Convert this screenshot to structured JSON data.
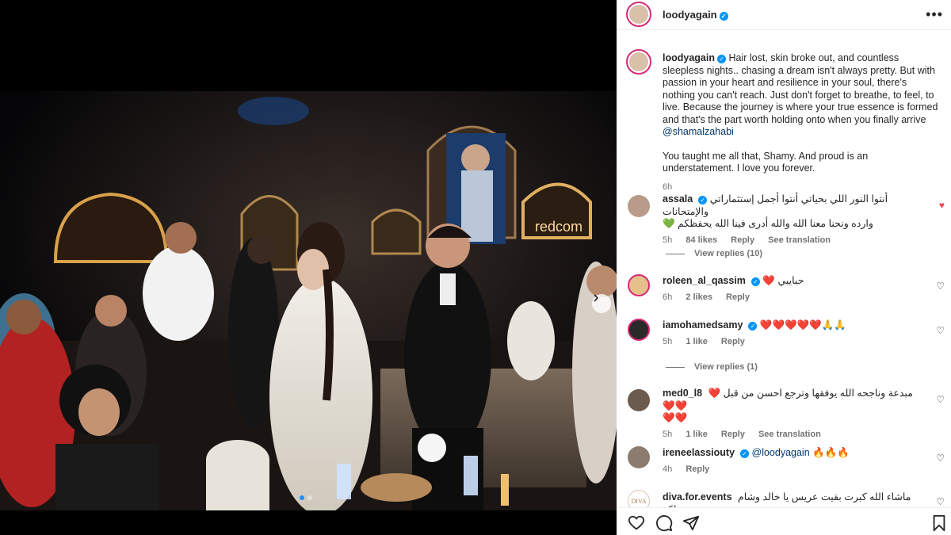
{
  "post": {
    "username": "loodyagain",
    "caption_p1": "Hair lost, skin broke out, and countless sleepless nights.. chasing a dream isn't always pretty. But with passion in your heart and resilience in your soul, there's nothing you can't reach. Just don't forget to breathe, to feel, to live. Because the journey is where your true essence is formed and that's the part worth holding onto when you finally arrive ",
    "caption_mention": "@shamalzahabi",
    "caption_p2": "You taught me all that, Shamy. And proud is an understatement. I love you forever.",
    "time": "6h"
  },
  "photo": {
    "screen_logo": "redcom"
  },
  "comments": [
    {
      "username": "assala",
      "verified": true,
      "text_line1": "أنتوا النور اللي بحياتي أنتوا أجمل إستثماراتي والإمتحانات",
      "text_line2": "وارده ونحنا معنا الله والله أدرى فينا الله يحفظكم 💚",
      "time": "5h",
      "likes": "84 likes",
      "reply": "Reply",
      "translation": "See translation",
      "view_replies": "View replies (10)"
    },
    {
      "username": "roleen_al_qassim",
      "verified": true,
      "text": "حبايبي ❤️",
      "time": "6h",
      "likes": "2 likes",
      "reply": "Reply"
    },
    {
      "username": "iamohamedsamy",
      "verified": true,
      "text": "❤️❤️❤️❤️❤️🙏🙏",
      "time": "5h",
      "likes": "1 like",
      "reply": "Reply",
      "view_replies": "View replies (1)"
    },
    {
      "username": "med0_l8",
      "verified": false,
      "text_line1": "مبدعة وناجحه الله يوفقها وترجع احسن من قبل ❤️❤️❤️",
      "text_line2": "❤️❤️",
      "time": "5h",
      "likes": "1 like",
      "reply": "Reply",
      "translation": "See translation"
    },
    {
      "username": "ireneelassiouty",
      "verified": true,
      "mention": "@loodyagain",
      "text": "🔥🔥🔥",
      "time": "4h",
      "reply": "Reply"
    },
    {
      "username": "diva.for.events",
      "verified": false,
      "text": "ماشاء الله كبرت بقيت عريس يا خالد وشام ملكة",
      "avatar_text": "DIVA"
    }
  ],
  "colors": {
    "verified_blue": "#0095f6",
    "like_red": "#ed4956",
    "mention_blue": "#00376b",
    "meta_gray": "#737373"
  }
}
